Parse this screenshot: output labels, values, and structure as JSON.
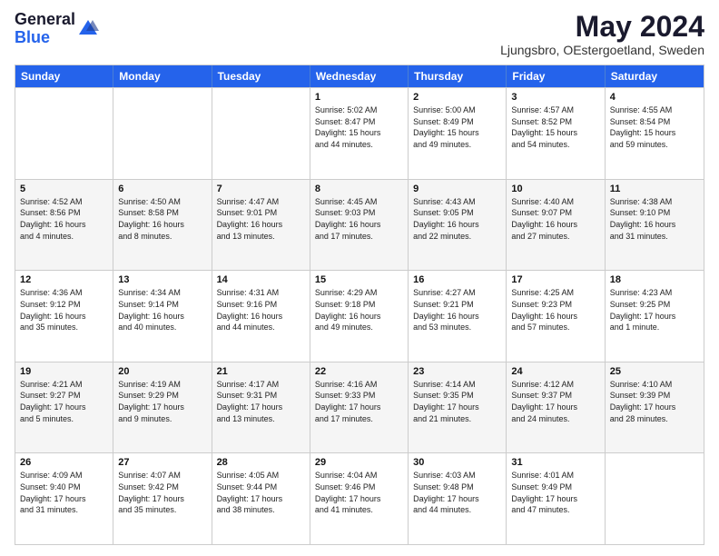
{
  "logo": {
    "general": "General",
    "blue": "Blue"
  },
  "title": {
    "month_year": "May 2024",
    "location": "Ljungsbro, OEstergoetland, Sweden"
  },
  "header_days": [
    "Sunday",
    "Monday",
    "Tuesday",
    "Wednesday",
    "Thursday",
    "Friday",
    "Saturday"
  ],
  "weeks": [
    [
      {
        "day": "",
        "info": ""
      },
      {
        "day": "",
        "info": ""
      },
      {
        "day": "",
        "info": ""
      },
      {
        "day": "1",
        "info": "Sunrise: 5:02 AM\nSunset: 8:47 PM\nDaylight: 15 hours\nand 44 minutes."
      },
      {
        "day": "2",
        "info": "Sunrise: 5:00 AM\nSunset: 8:49 PM\nDaylight: 15 hours\nand 49 minutes."
      },
      {
        "day": "3",
        "info": "Sunrise: 4:57 AM\nSunset: 8:52 PM\nDaylight: 15 hours\nand 54 minutes."
      },
      {
        "day": "4",
        "info": "Sunrise: 4:55 AM\nSunset: 8:54 PM\nDaylight: 15 hours\nand 59 minutes."
      }
    ],
    [
      {
        "day": "5",
        "info": "Sunrise: 4:52 AM\nSunset: 8:56 PM\nDaylight: 16 hours\nand 4 minutes."
      },
      {
        "day": "6",
        "info": "Sunrise: 4:50 AM\nSunset: 8:58 PM\nDaylight: 16 hours\nand 8 minutes."
      },
      {
        "day": "7",
        "info": "Sunrise: 4:47 AM\nSunset: 9:01 PM\nDaylight: 16 hours\nand 13 minutes."
      },
      {
        "day": "8",
        "info": "Sunrise: 4:45 AM\nSunset: 9:03 PM\nDaylight: 16 hours\nand 17 minutes."
      },
      {
        "day": "9",
        "info": "Sunrise: 4:43 AM\nSunset: 9:05 PM\nDaylight: 16 hours\nand 22 minutes."
      },
      {
        "day": "10",
        "info": "Sunrise: 4:40 AM\nSunset: 9:07 PM\nDaylight: 16 hours\nand 27 minutes."
      },
      {
        "day": "11",
        "info": "Sunrise: 4:38 AM\nSunset: 9:10 PM\nDaylight: 16 hours\nand 31 minutes."
      }
    ],
    [
      {
        "day": "12",
        "info": "Sunrise: 4:36 AM\nSunset: 9:12 PM\nDaylight: 16 hours\nand 35 minutes."
      },
      {
        "day": "13",
        "info": "Sunrise: 4:34 AM\nSunset: 9:14 PM\nDaylight: 16 hours\nand 40 minutes."
      },
      {
        "day": "14",
        "info": "Sunrise: 4:31 AM\nSunset: 9:16 PM\nDaylight: 16 hours\nand 44 minutes."
      },
      {
        "day": "15",
        "info": "Sunrise: 4:29 AM\nSunset: 9:18 PM\nDaylight: 16 hours\nand 49 minutes."
      },
      {
        "day": "16",
        "info": "Sunrise: 4:27 AM\nSunset: 9:21 PM\nDaylight: 16 hours\nand 53 minutes."
      },
      {
        "day": "17",
        "info": "Sunrise: 4:25 AM\nSunset: 9:23 PM\nDaylight: 16 hours\nand 57 minutes."
      },
      {
        "day": "18",
        "info": "Sunrise: 4:23 AM\nSunset: 9:25 PM\nDaylight: 17 hours\nand 1 minute."
      }
    ],
    [
      {
        "day": "19",
        "info": "Sunrise: 4:21 AM\nSunset: 9:27 PM\nDaylight: 17 hours\nand 5 minutes."
      },
      {
        "day": "20",
        "info": "Sunrise: 4:19 AM\nSunset: 9:29 PM\nDaylight: 17 hours\nand 9 minutes."
      },
      {
        "day": "21",
        "info": "Sunrise: 4:17 AM\nSunset: 9:31 PM\nDaylight: 17 hours\nand 13 minutes."
      },
      {
        "day": "22",
        "info": "Sunrise: 4:16 AM\nSunset: 9:33 PM\nDaylight: 17 hours\nand 17 minutes."
      },
      {
        "day": "23",
        "info": "Sunrise: 4:14 AM\nSunset: 9:35 PM\nDaylight: 17 hours\nand 21 minutes."
      },
      {
        "day": "24",
        "info": "Sunrise: 4:12 AM\nSunset: 9:37 PM\nDaylight: 17 hours\nand 24 minutes."
      },
      {
        "day": "25",
        "info": "Sunrise: 4:10 AM\nSunset: 9:39 PM\nDaylight: 17 hours\nand 28 minutes."
      }
    ],
    [
      {
        "day": "26",
        "info": "Sunrise: 4:09 AM\nSunset: 9:40 PM\nDaylight: 17 hours\nand 31 minutes."
      },
      {
        "day": "27",
        "info": "Sunrise: 4:07 AM\nSunset: 9:42 PM\nDaylight: 17 hours\nand 35 minutes."
      },
      {
        "day": "28",
        "info": "Sunrise: 4:05 AM\nSunset: 9:44 PM\nDaylight: 17 hours\nand 38 minutes."
      },
      {
        "day": "29",
        "info": "Sunrise: 4:04 AM\nSunset: 9:46 PM\nDaylight: 17 hours\nand 41 minutes."
      },
      {
        "day": "30",
        "info": "Sunrise: 4:03 AM\nSunset: 9:48 PM\nDaylight: 17 hours\nand 44 minutes."
      },
      {
        "day": "31",
        "info": "Sunrise: 4:01 AM\nSunset: 9:49 PM\nDaylight: 17 hours\nand 47 minutes."
      },
      {
        "day": "",
        "info": ""
      }
    ]
  ]
}
